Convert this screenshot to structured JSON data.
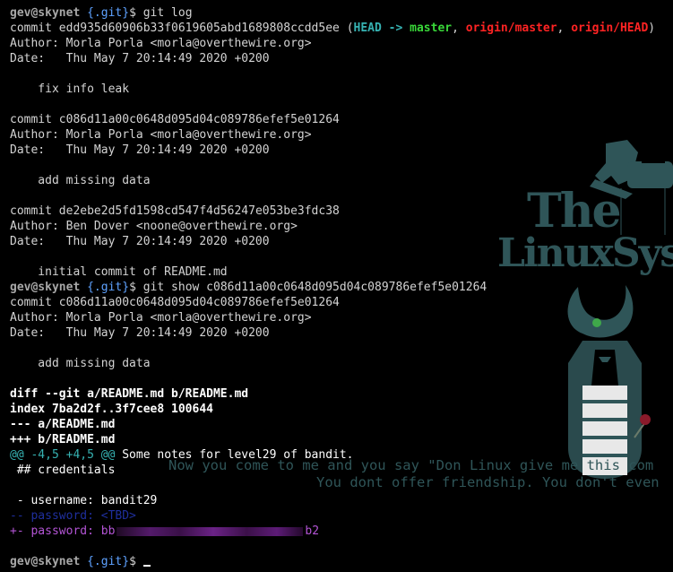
{
  "wallpaper": {
    "logo_line1": "The",
    "logo_line2": "LinuxSyste",
    "quote_line1": "Now you come to me and you say \"Don Linux give me this com",
    "quote_line2": "You dont offer friendship. You don't even"
  },
  "prompt": {
    "user": "gev@skynet",
    "dir": "{.git}",
    "symbol": "$"
  },
  "log": {
    "command": " git log",
    "commits": [
      {
        "commit_label": "commit ",
        "hash": "edd935d60906b33f0619605abd1689808ccdd5ee",
        "author": "Author: Morla Porla <morla@overthewire.org>",
        "date": "Date:   Thu May 7 20:14:49 2020 +0200",
        "message": "    fix info leak"
      },
      {
        "commit_label": "commit ",
        "hash": "c086d11a00c0648d095d04c089786efef5e01264",
        "author": "Author: Morla Porla <morla@overthewire.org>",
        "date": "Date:   Thu May 7 20:14:49 2020 +0200",
        "message": "    add missing data"
      },
      {
        "commit_label": "commit ",
        "hash": "de2ebe2d5fd1598cd547f4d56247e053be3fdc38",
        "author": "Author: Ben Dover <noone@overthewire.org>",
        "date": "Date:   Thu May 7 20:14:49 2020 +0200",
        "message": "    initial commit of README.md"
      }
    ],
    "refs": {
      "open": " (",
      "head": "HEAD -> ",
      "branch": "master",
      "sep1": ", ",
      "origin_master": "origin/master",
      "sep2": ", ",
      "origin_head": "origin/HEAD",
      "close": ")"
    }
  },
  "show": {
    "command": " git show c086d11a00c0648d095d04c089786efef5e01264",
    "commit": "commit c086d11a00c0648d095d04c089786efef5e01264",
    "author": "Author: Morla Porla <morla@overthewire.org>",
    "date": "Date:   Thu May 7 20:14:49 2020 +0200",
    "message": "    add missing data",
    "diff_header": "diff --git a/README.md b/README.md",
    "index": "index 7ba2d2f..3f7cee8 100644",
    "minus_file": "--- a/README.md",
    "plus_file": "+++ b/README.md",
    "hunk": "@@ -4,5 +4,5 @@",
    "hunk_context": " Some notes for level29 of bandit.",
    "credentials_heading": " ## credentials",
    "username_line": " - username: bandit29",
    "removed_line": "-- password: <TBD>",
    "added_prefix": "+- password: bb",
    "added_suffix": "b2"
  },
  "final_prompt_cmd": " "
}
